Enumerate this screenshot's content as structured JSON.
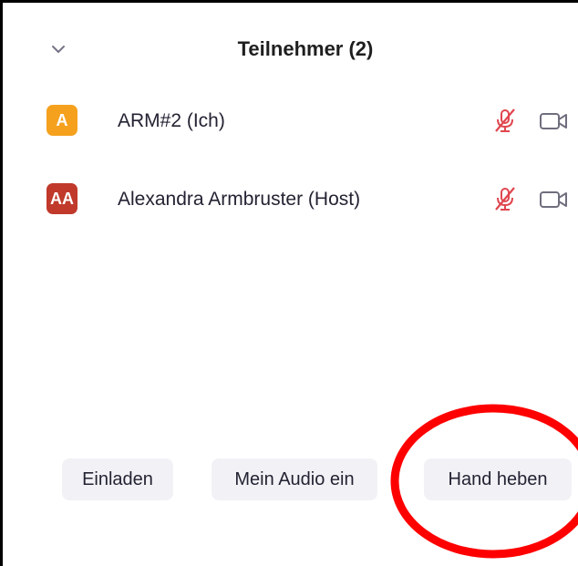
{
  "header": {
    "title": "Teilnehmer (2)",
    "collapse_icon": "chevron-down-icon"
  },
  "participants": [
    {
      "initials": "A",
      "avatar_color": "#f5a11e",
      "name": "ARM#2 (Ich)",
      "mic_icon": "mic-muted-icon",
      "video_icon": "video-off-icon"
    },
    {
      "initials": "AA",
      "avatar_color": "#c0392b",
      "name": "Alexandra Armbruster (Host)",
      "mic_icon": "mic-muted-icon",
      "video_icon": "video-off-icon"
    }
  ],
  "footer": {
    "invite_label": "Einladen",
    "audio_label": "Mein Audio ein",
    "raise_hand_label": "Hand heben"
  },
  "colors": {
    "muted_red": "#e0464f",
    "annotation_red": "#ff0000",
    "button_bg": "#f2f2f6"
  }
}
